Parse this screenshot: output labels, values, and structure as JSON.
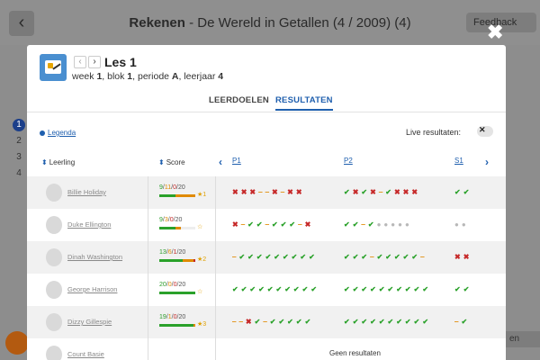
{
  "background": {
    "title_bold": "Rekenen",
    "title_rest": " - De Wereld in Getallen (4 / 2009) (4)",
    "back_icon": "chevron-left-icon",
    "feedback_label": "Feedback",
    "side_numbers": [
      "1",
      "2",
      "3",
      "4"
    ],
    "ok_label": "en"
  },
  "modal": {
    "close_icon": "close-icon",
    "lesson_title": "Les 1",
    "subtitle": {
      "week_label": "week ",
      "week": "1",
      "blok_label": ", blok ",
      "blok": "1",
      "periode_label": ", periode ",
      "periode": "A",
      "leerjaar_label": ", leerjaar ",
      "leerjaar": "4"
    },
    "tabs": [
      "LEERDOELEN",
      "RESULTATEN"
    ],
    "active_tab": "RESULTATEN",
    "legend_label": "Legenda",
    "live_label": "Live resultaten:",
    "live_toggle_on": false,
    "columns": {
      "student": "Leerling",
      "score": "Score"
    },
    "periods": [
      "P1",
      "P2",
      "S1"
    ]
  },
  "colors": {
    "accent": "#1f5fae",
    "good": "#2aa12a",
    "bad": "#c62828",
    "warn": "#e08a00"
  },
  "students": [
    {
      "name": "Billie Holiday",
      "score_good": "9",
      "score_warn": "11",
      "score_bad": "0",
      "score_total": "20",
      "medal": "1",
      "p1": "✖✖✖‒‒✖‒✖✖",
      "p2": "✔✖✔✖‒✔✖✖✖",
      "s1": "✔✔"
    },
    {
      "name": "Duke Ellington",
      "score_good": "9",
      "score_warn": "3",
      "score_bad": "0",
      "score_total": "20",
      "medal": "",
      "p1": "✖‒✔✔‒✔✔✔‒✖",
      "p2": "✔✔‒✔●●●●●",
      "s1": "●●"
    },
    {
      "name": "Dinah Washington",
      "score_good": "13",
      "score_warn": "6",
      "score_bad": "1",
      "score_total": "20",
      "medal": "2",
      "p1": "‒✔✔✔✔✔✔✔✔✔",
      "p2": "✔✔✔‒✔✔✔✔✔‒",
      "s1": "✖✖"
    },
    {
      "name": "George Harrison",
      "score_good": "20",
      "score_warn": "0",
      "score_bad": "0",
      "score_total": "20",
      "medal": "",
      "p1": "✔✔✔✔✔✔✔✔✔✔",
      "p2": "✔✔✔✔✔✔✔✔✔✔",
      "s1": "✔✔"
    },
    {
      "name": "Dizzy Gillespie",
      "score_good": "19",
      "score_warn": "1",
      "score_bad": "0",
      "score_total": "20",
      "medal": "3",
      "p1": "‒‒✖✔‒✔✔✔✔✔",
      "p2": "✔✔✔✔✔✔✔✔✔✔",
      "s1": "‒✔"
    },
    {
      "name": "Count Basie",
      "no_results": "Geen resultaten"
    }
  ]
}
